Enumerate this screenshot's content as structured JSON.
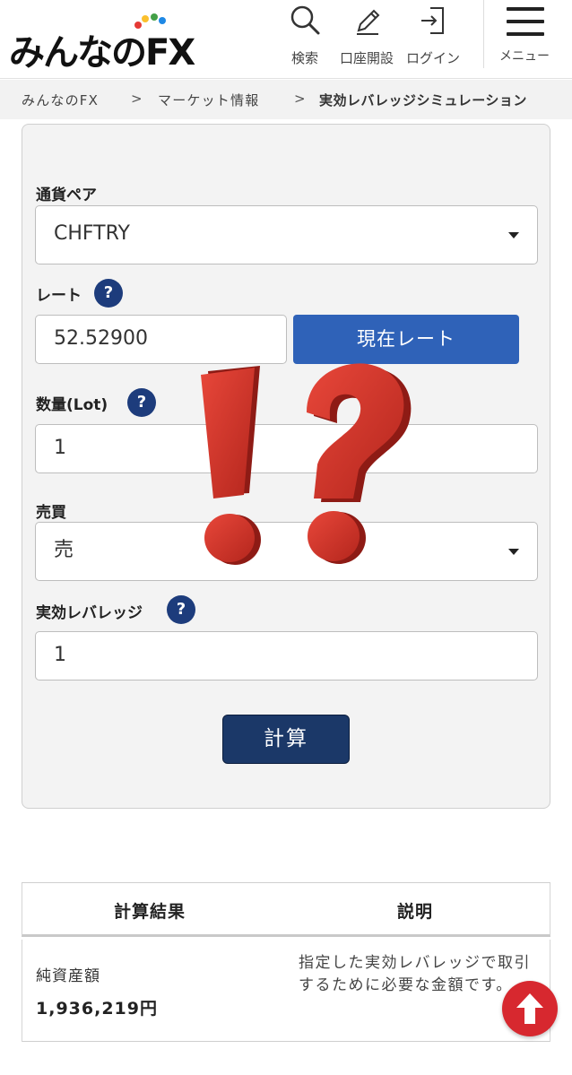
{
  "header": {
    "logo_text": "みんなのFX",
    "search_label": "検索",
    "open_account_label": "口座開設",
    "login_label": "ログイン",
    "menu_label": "メニュー"
  },
  "breadcrumb": [
    "みんなのFX",
    "マーケット情報",
    "実効レバレッジシミュレーション"
  ],
  "breadcrumb_separator": ">",
  "form": {
    "currency_pair_label": "通貨ペア",
    "currency_pair_value": "CHFTRY",
    "rate_label": "レート",
    "rate_value": "52.52900",
    "current_rate_button": "現在レート",
    "quantity_label": "数量(Lot)",
    "quantity_value": "1",
    "trade_label": "売買",
    "trade_value": "売",
    "leverage_label": "実効レバレッジ",
    "leverage_value": "1",
    "help_glyph": "?",
    "calculate_button": "計算"
  },
  "result": {
    "col_result": "計算結果",
    "col_description": "説明",
    "row_name": "純資産額",
    "row_value": "1,936,219円",
    "row_description": "指定した実効レバレッジで取引するために必要な金額です。"
  },
  "colors": {
    "help_badge": "#1d3c7c",
    "current_rate_button": "#2f62b8",
    "calculate_button": "#1b3868",
    "scroll_top": "#d7282f",
    "overlay_mark": "#d63a2c"
  },
  "icons": [
    "search-icon",
    "pencil-icon",
    "login-icon",
    "hamburger-icon",
    "help-icon",
    "chevron-down-icon",
    "arrow-up-icon",
    "exclamation-question-overlay"
  ]
}
